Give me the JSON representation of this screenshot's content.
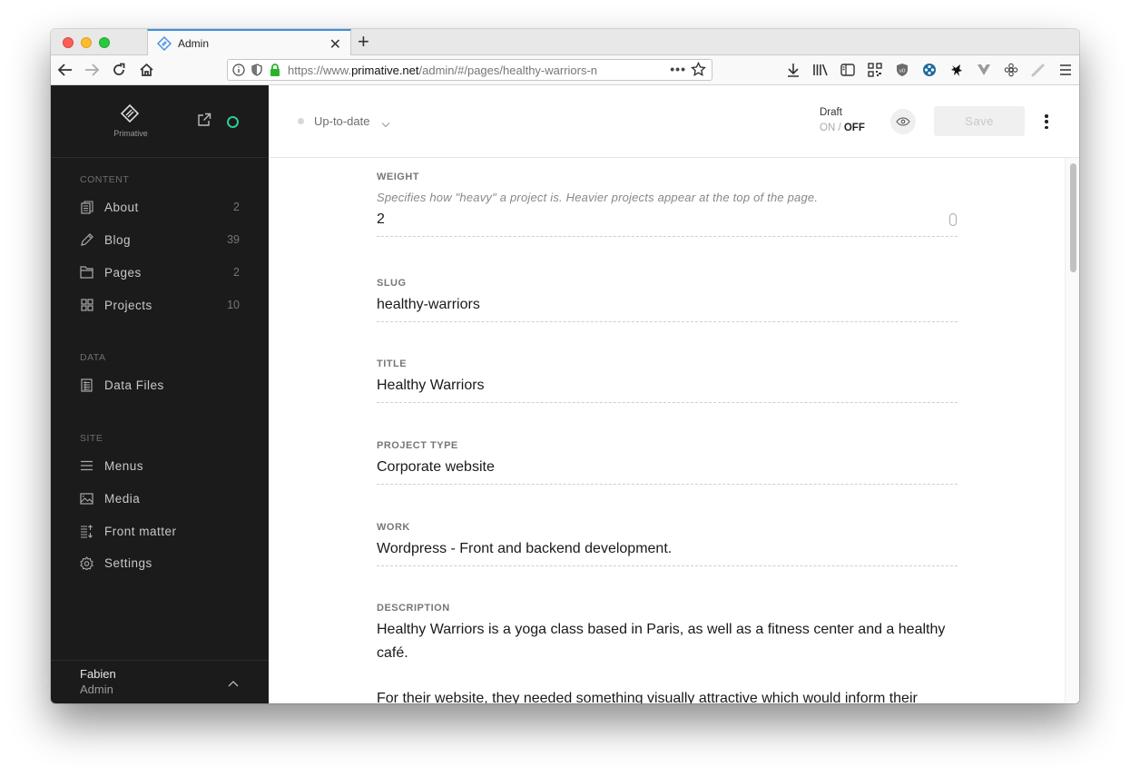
{
  "browser": {
    "tab_title": "Admin",
    "url_prefix": "https://www.",
    "url_domain": "primative.net",
    "url_path": "/admin/#/pages/healthy-warriors-n",
    "url_more": "•••"
  },
  "sidebar": {
    "brand": "Primative",
    "sections": [
      {
        "label": "CONTENT",
        "items": [
          {
            "label": "About",
            "count": "2",
            "icon": "documents-icon"
          },
          {
            "label": "Blog",
            "count": "39",
            "icon": "pencil-icon"
          },
          {
            "label": "Pages",
            "count": "2",
            "icon": "folder-icon"
          },
          {
            "label": "Projects",
            "count": "10",
            "icon": "grid-icon"
          }
        ]
      },
      {
        "label": "DATA",
        "items": [
          {
            "label": "Data Files",
            "icon": "data-file-icon"
          }
        ]
      },
      {
        "label": "SITE",
        "items": [
          {
            "label": "Menus",
            "icon": "menu-lines-icon"
          },
          {
            "label": "Media",
            "icon": "image-icon"
          },
          {
            "label": "Front matter",
            "icon": "front-matter-icon"
          },
          {
            "label": "Settings",
            "icon": "gear-icon"
          }
        ]
      }
    ],
    "user": {
      "name": "Fabien",
      "role": "Admin"
    }
  },
  "topbar": {
    "status": "Up-to-date",
    "draft_label": "Draft",
    "draft_on": "ON",
    "draft_sep": " / ",
    "draft_off": "OFF",
    "save_label": "Save"
  },
  "fields": [
    {
      "label": "WEIGHT",
      "help": "Specifies how \"heavy\" a project is. Heavier projects appear at the top of the page.",
      "value": "2"
    },
    {
      "label": "SLUG",
      "value": "healthy-warriors"
    },
    {
      "label": "TITLE",
      "value": "Healthy Warriors"
    },
    {
      "label": "PROJECT TYPE",
      "value": "Corporate website"
    },
    {
      "label": "WORK",
      "value": "Wordpress - Front and backend development."
    },
    {
      "label": "DESCRIPTION",
      "paragraphs": [
        "Healthy Warriors is a yoga class based in Paris, as well as a fitness center and a healthy café.",
        "For their website, they needed something visually attractive which would inform their"
      ]
    }
  ],
  "colors": {
    "accent_tab": "#3d8fe0",
    "status_ring": "#2ecc9a",
    "sidebar_bg": "#1b1b1b"
  }
}
